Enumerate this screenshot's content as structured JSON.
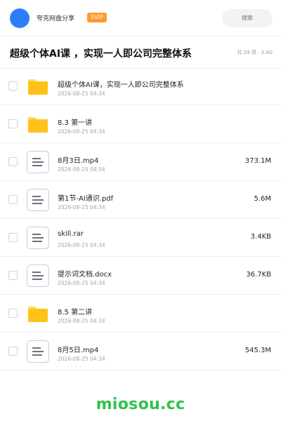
{
  "header": {
    "share_name": "夸克网盘分享",
    "badge": "SVIP",
    "search_placeholder": "搜索"
  },
  "share": {
    "title": "超级个体AI课 ，实现一人即公司完整体系",
    "meta": "共 29 项 · 3.4G"
  },
  "files": [
    {
      "name": "超级个体AI课，实现一人即公司完整体系",
      "date": "2026-08-25 04:34",
      "size": "",
      "type": "folder"
    },
    {
      "name": "8.3 第一讲",
      "date": "2026-08-25 04:34",
      "size": "",
      "type": "folder"
    },
    {
      "name": "8月3日.mp4",
      "date": "2026-08-25 04:34",
      "size": "373.1M",
      "type": "file"
    },
    {
      "name": "第1节-AI通识.pdf",
      "date": "2026-08-25 04:34",
      "size": "5.6M",
      "type": "file"
    },
    {
      "name": "skill.rar",
      "date": "2026-08-25 04:34",
      "size": "3.4KB",
      "type": "file"
    },
    {
      "name": "提示词文档.docx",
      "date": "2026-08-25 04:34",
      "size": "36.7KB",
      "type": "file"
    },
    {
      "name": "8.5 第二讲",
      "date": "2026-08-25 04:34",
      "size": "",
      "type": "folder"
    },
    {
      "name": "8月5日.mp4",
      "date": "2026-08-25 04:34",
      "size": "545.3M",
      "type": "file"
    }
  ],
  "watermark": "miosou.cc",
  "colors": {
    "avatar": "#2c7ef8",
    "badge": "#ff9a2e",
    "folder": "#ffc21a",
    "watermark": "#2fc24b"
  }
}
